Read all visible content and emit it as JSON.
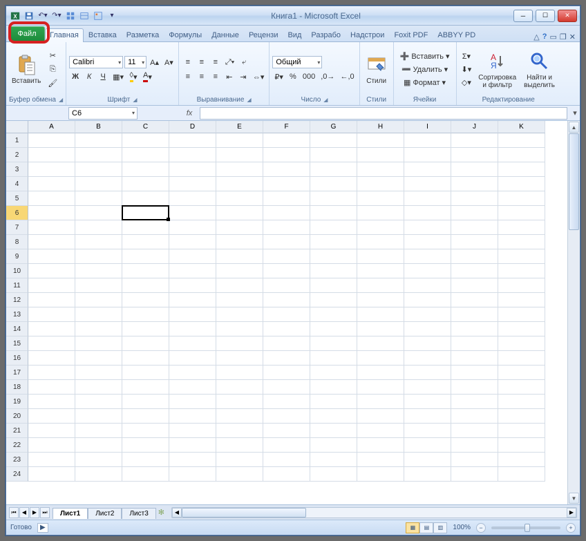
{
  "title": "Книга1 - Microsoft Excel",
  "tabs": {
    "file": "Файл",
    "items": [
      "Главная",
      "Вставка",
      "Разметка",
      "Формулы",
      "Данные",
      "Рецензи",
      "Вид",
      "Разрабо",
      "Надстрои",
      "Foxit PDF",
      "ABBYY PD"
    ],
    "active_index": 0
  },
  "ribbon": {
    "clipboard": {
      "paste": "Вставить",
      "label": "Буфер обмена"
    },
    "font": {
      "name": "Calibri",
      "size": "11",
      "label": "Шрифт",
      "bold": "Ж",
      "italic": "К",
      "underline": "Ч"
    },
    "align": {
      "label": "Выравнивание"
    },
    "number": {
      "format": "Общий",
      "label": "Число"
    },
    "styles": {
      "label": "Стили",
      "btn": "Стили"
    },
    "cells": {
      "insert": "Вставить",
      "delete": "Удалить",
      "format": "Формат",
      "label": "Ячейки"
    },
    "editing": {
      "sortfilter": "Сортировка\nи фильтр",
      "findselect": "Найти и\nвыделить",
      "label": "Редактирование"
    }
  },
  "namebox": "C6",
  "fx": "fx",
  "columns": [
    "A",
    "B",
    "C",
    "D",
    "E",
    "F",
    "G",
    "H",
    "I",
    "J",
    "K"
  ],
  "rows": [
    "1",
    "2",
    "3",
    "4",
    "5",
    "6",
    "7",
    "8",
    "9",
    "10",
    "11",
    "12",
    "13",
    "14",
    "15",
    "16",
    "17",
    "18",
    "19",
    "20",
    "21",
    "22",
    "23",
    "24"
  ],
  "selected_row": "6",
  "sheets": {
    "active": "Лист1",
    "items": [
      "Лист1",
      "Лист2",
      "Лист3"
    ]
  },
  "status": {
    "ready": "Готово",
    "zoom": "100%"
  }
}
